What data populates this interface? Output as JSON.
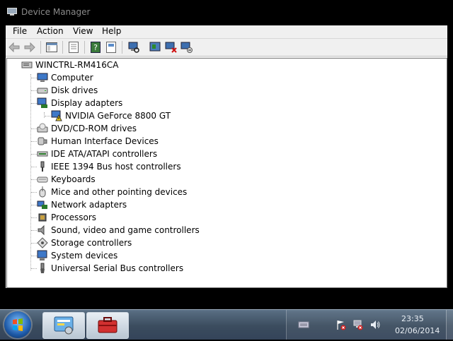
{
  "window": {
    "title": "Device Manager"
  },
  "menu": [
    "File",
    "Action",
    "View",
    "Help"
  ],
  "toolbar": {
    "buttons": [
      "back-icon",
      "forward-icon",
      "show-hide-console-tree-icon",
      "properties-icon",
      "help-icon",
      "scan-hardware-icon",
      "update-driver-icon",
      "uninstall-device-icon",
      "disable-device-icon"
    ]
  },
  "tree": {
    "root": "WINCTRL-RM416CA",
    "categories": [
      {
        "label": "Computer",
        "icon": "computer-icon"
      },
      {
        "label": "Disk drives",
        "icon": "disk-drive-icon"
      },
      {
        "label": "Display adapters",
        "icon": "display-adapter-icon",
        "expanded": true,
        "children": [
          {
            "label": "NVIDIA GeForce 8800 GT",
            "icon": "display-adapter-warning-icon"
          }
        ]
      },
      {
        "label": "DVD/CD-ROM drives",
        "icon": "dvd-drive-icon"
      },
      {
        "label": "Human Interface Devices",
        "icon": "hid-icon"
      },
      {
        "label": "IDE ATA/ATAPI controllers",
        "icon": "ide-controller-icon"
      },
      {
        "label": "IEEE 1394 Bus host controllers",
        "icon": "ieee1394-icon"
      },
      {
        "label": "Keyboards",
        "icon": "keyboard-icon"
      },
      {
        "label": "Mice and other pointing devices",
        "icon": "mouse-icon"
      },
      {
        "label": "Network adapters",
        "icon": "network-adapter-icon"
      },
      {
        "label": "Processors",
        "icon": "processor-icon"
      },
      {
        "label": "Sound, video and game controllers",
        "icon": "sound-icon"
      },
      {
        "label": "Storage controllers",
        "icon": "storage-controller-icon"
      },
      {
        "label": "System devices",
        "icon": "system-devices-icon"
      },
      {
        "label": "Universal Serial Bus controllers",
        "icon": "usb-icon"
      }
    ]
  },
  "taskbar": {
    "buttons": [
      "control-panel-icon",
      "toolbox-icon"
    ],
    "tray_icons": [
      "keyboard-tray-icon",
      "action-center-icon",
      "network-icon",
      "volume-icon"
    ],
    "time": "23:35",
    "date": "02/06/2014"
  }
}
